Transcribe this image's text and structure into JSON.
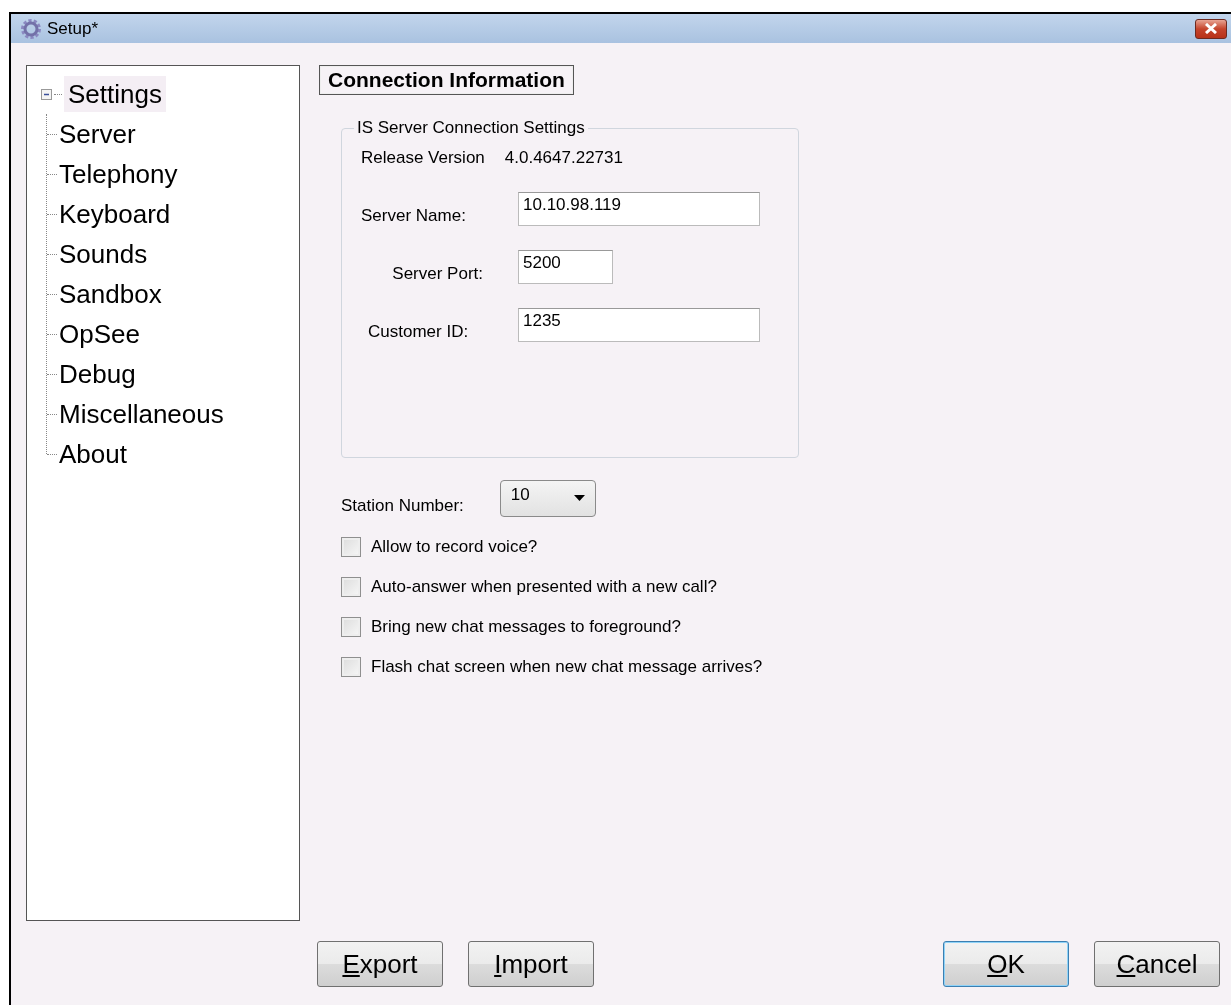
{
  "window": {
    "title": "Setup*"
  },
  "tree": {
    "label": "Settings",
    "expanded": true,
    "selected": true,
    "children": [
      {
        "label": "Server",
        "selected": false
      },
      {
        "label": "Telephony",
        "selected": false
      },
      {
        "label": "Keyboard",
        "selected": false
      },
      {
        "label": "Sounds",
        "selected": false
      },
      {
        "label": "Sandbox",
        "selected": false
      },
      {
        "label": "OpSee",
        "selected": false
      },
      {
        "label": "Debug",
        "selected": false
      },
      {
        "label": "Miscellaneous",
        "selected": false
      },
      {
        "label": "About",
        "selected": false
      }
    ]
  },
  "section_title": "Connection Information",
  "group": {
    "title": "IS Server Connection Settings",
    "version_label": "Release Version",
    "version_value": "4.0.4647.22731",
    "fields": [
      {
        "label": "Server Name:",
        "value": "10.10.98.119",
        "kind": "wide"
      },
      {
        "label": "Server Port:",
        "value": "5200",
        "kind": "narrow"
      },
      {
        "label": "Customer ID:",
        "value": "1235",
        "kind": "wide"
      }
    ]
  },
  "station": {
    "label": "Station Number:",
    "value": "10"
  },
  "options": [
    {
      "label": "Allow to record voice?",
      "checked": false
    },
    {
      "label": "Auto-answer when presented with a new call?",
      "checked": false
    },
    {
      "label": "Bring new chat messages to foreground?",
      "checked": false
    },
    {
      "label": "Flash chat screen when new chat message arrives?",
      "checked": false
    }
  ],
  "buttons_left": [
    {
      "label": "Export",
      "default": false
    },
    {
      "label": "Import",
      "default": false
    }
  ],
  "buttons_right": [
    {
      "label": "OK",
      "default": true
    },
    {
      "label": "Cancel",
      "default": false
    }
  ]
}
